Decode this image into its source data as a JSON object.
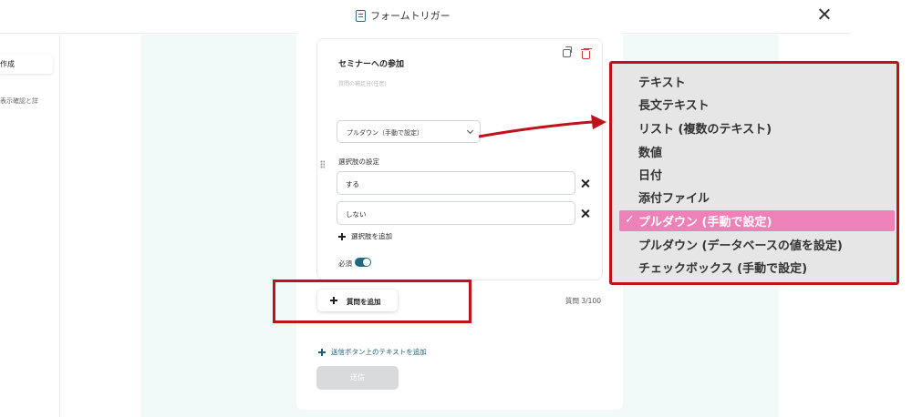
{
  "header": {
    "title": "フォームトリガー"
  },
  "left_panel": {
    "active_label": "作成",
    "item_label": "表示確認と詳"
  },
  "question": {
    "title": "セミナーへの参加",
    "helper_placeholder": "質問の補足分(任意)",
    "type_value": "プルダウン（手動で設定）",
    "options_title": "選択肢の設定",
    "options": [
      "する",
      "しない"
    ],
    "add_option_label": "選択肢を追加",
    "required_label": "必須",
    "required": true
  },
  "footer": {
    "add_question_label": "質問を追加",
    "question_count": "質問 3/100",
    "add_text_label": "送信ボタン上のテキストを追加",
    "submit_label": "送信"
  },
  "dropdown": {
    "items": [
      "テキスト",
      "長文テキスト",
      "リスト (複数のテキスト)",
      "数値",
      "日付",
      "添付ファイル",
      "プルダウン (手動で設定)",
      "プルダウン (データベースの値を設定)",
      "チェックボックス (手動で設定)"
    ],
    "selected": "プルダウン (手動で設定)"
  },
  "colors": {
    "accent": "#1f6a80",
    "highlight": "#c1121c",
    "selected_bg": "#ee82b8"
  }
}
